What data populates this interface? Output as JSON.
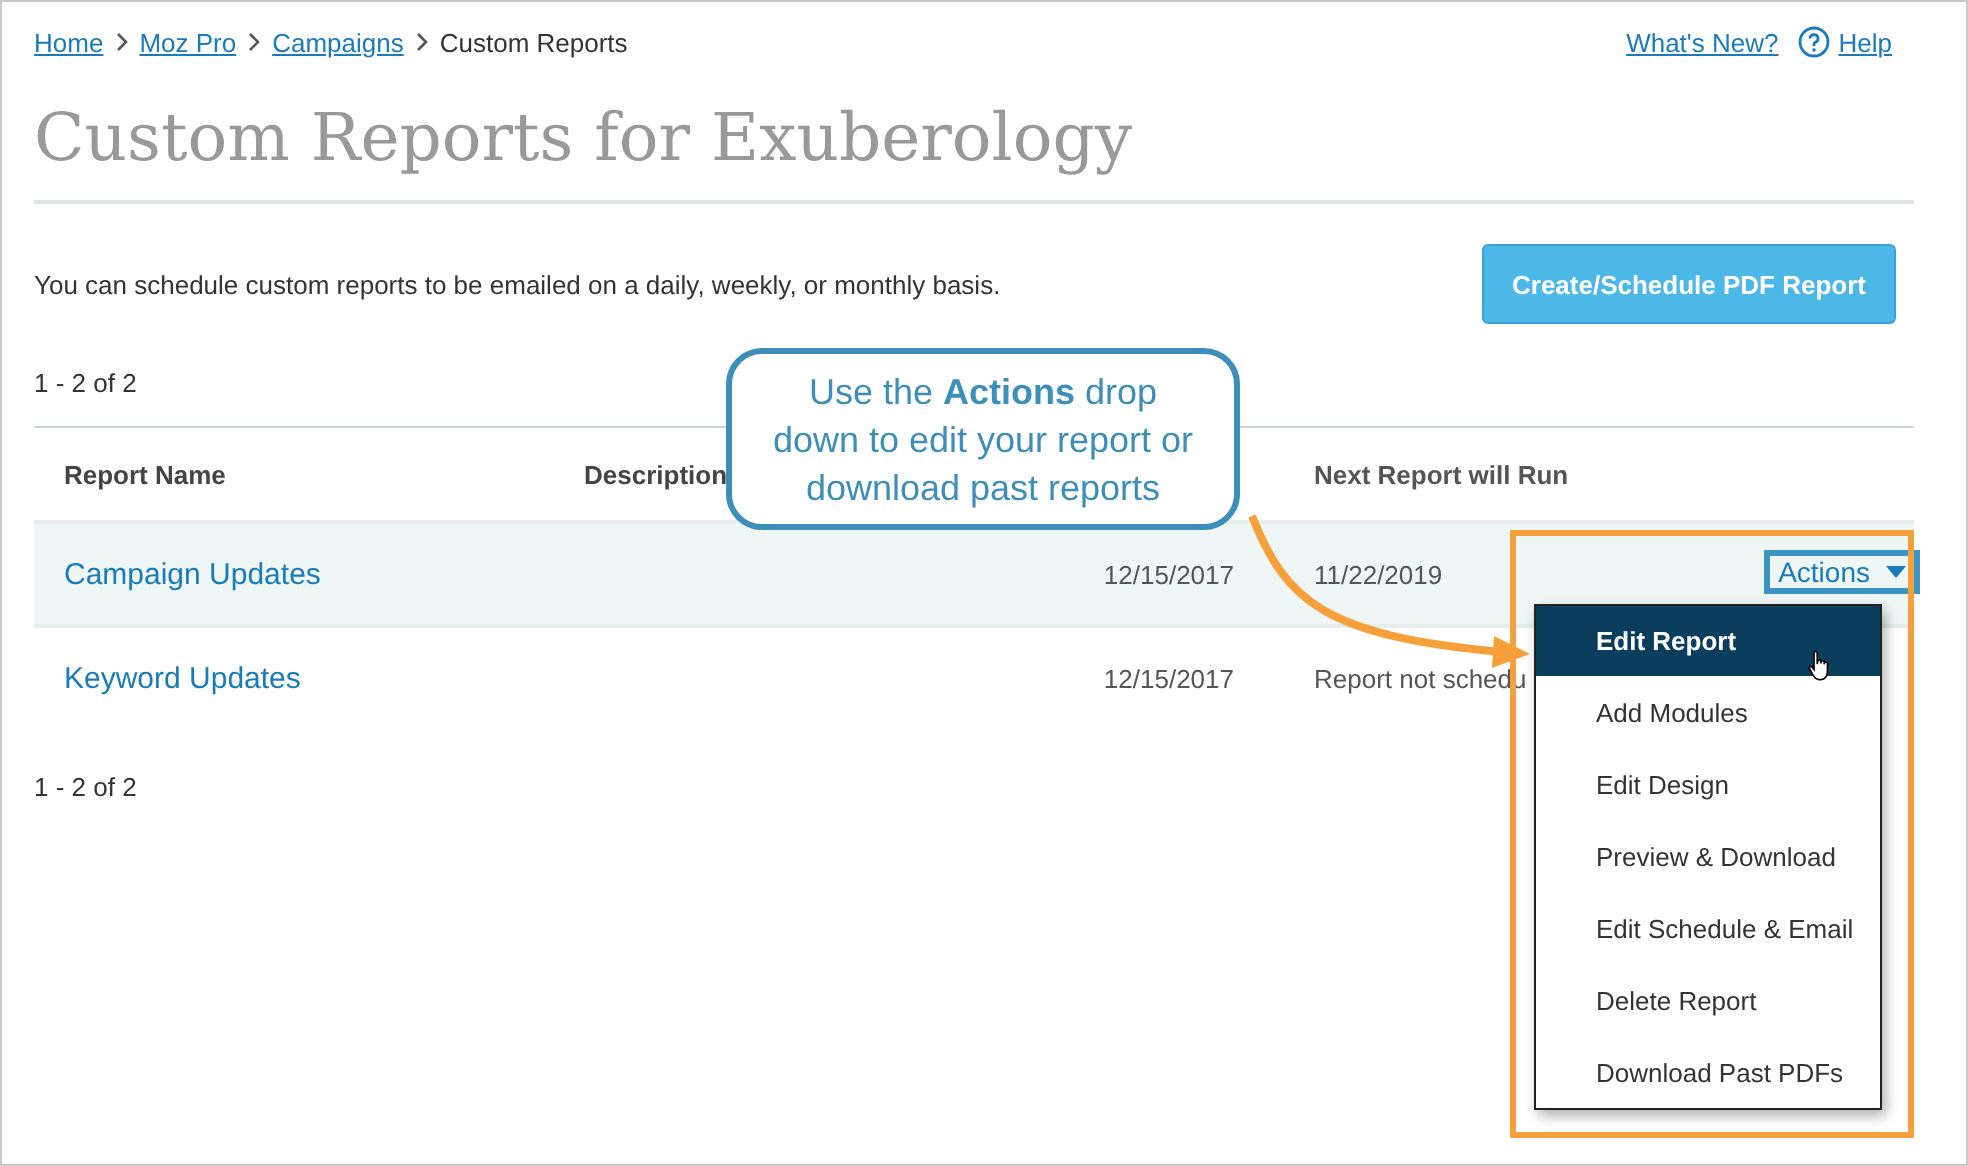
{
  "breadcrumb": {
    "links": [
      "Home",
      "Moz Pro",
      "Campaigns"
    ],
    "current": "Custom Reports"
  },
  "header_links": {
    "whats_new": "What's New?",
    "help": "Help"
  },
  "title": "Custom Reports for Exuberology",
  "intro": "You can schedule custom reports to be emailed on a daily, weekly, or monthly basis.",
  "create_button": "Create/Schedule PDF Report",
  "count_top": "1 - 2 of 2",
  "table": {
    "columns": [
      "Report Name",
      "Description",
      "Next Report will Run"
    ],
    "rows": [
      {
        "name": "Campaign Updates",
        "date": "12/15/2017",
        "next_run": "11/22/2019",
        "highlighted": true
      },
      {
        "name": "Keyword Updates",
        "date": "12/15/2017",
        "next_run": "Report not schedu",
        "highlighted": false
      }
    ]
  },
  "actions_button": "Actions",
  "actions_menu": [
    {
      "label": "Edit Report",
      "selected": true
    },
    {
      "label": "Add Modules",
      "selected": false
    },
    {
      "label": "Edit Design",
      "selected": false
    },
    {
      "label": "Preview & Download",
      "selected": false
    },
    {
      "label": "Edit Schedule & Email",
      "selected": false
    },
    {
      "label": "Delete Report",
      "selected": false
    },
    {
      "label": "Download Past PDFs",
      "selected": false
    }
  ],
  "count_bottom": "1 - 2 of 2",
  "callout": "Use the **Actions** drop down to edit your report or download past reports"
}
